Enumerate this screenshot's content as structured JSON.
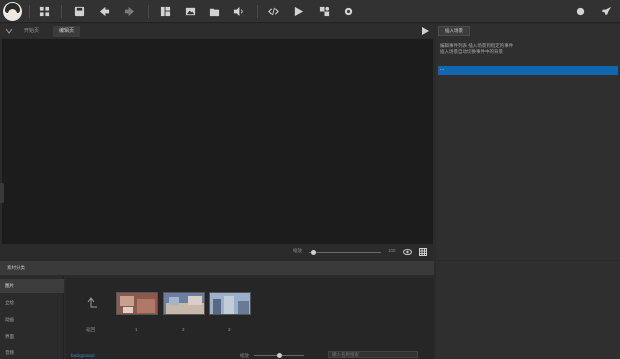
{
  "toolbar": {
    "buttons": [
      {
        "name": "project-grid-icon"
      },
      {
        "name": "save-icon"
      },
      {
        "name": "back-icon"
      },
      {
        "name": "forward-icon"
      },
      {
        "name": "layout-icon"
      },
      {
        "name": "image-icon"
      },
      {
        "name": "folder-icon"
      },
      {
        "name": "volume-icon"
      },
      {
        "name": "code-icon"
      },
      {
        "name": "play-icon"
      },
      {
        "name": "assets-icon"
      },
      {
        "name": "settings-icon"
      },
      {
        "name": "record-icon"
      },
      {
        "name": "rocket-icon"
      }
    ]
  },
  "editor": {
    "tabs": [
      {
        "label": "开始页",
        "active": false
      },
      {
        "label": "编辑页",
        "active": true
      }
    ]
  },
  "zoombar": {
    "zoom_label": "缩放",
    "zoom_value": 0.05,
    "percent_label": "100",
    "grid_icon": "grid-icon"
  },
  "right_panel": {
    "button_label": "插入场景",
    "hint_line1": "编辑事件列表 插入场景到指定的事件",
    "hint_line2": "插入场景自动切换事件中的背景",
    "selected_item": "..."
  },
  "bottom": {
    "title": "素材分类",
    "categories": [
      {
        "label": "图片",
        "active": true
      },
      {
        "label": "立绘",
        "active": false
      },
      {
        "label": "动画",
        "active": false
      },
      {
        "label": "界面",
        "active": false
      },
      {
        "label": "音频",
        "active": false
      }
    ],
    "parent_label": "返回",
    "thumbnails": [
      {
        "label": "1",
        "color": "#a87060"
      },
      {
        "label": "2",
        "color": "#7a8aa8"
      },
      {
        "label": "3",
        "color": "#8aa0c0"
      }
    ],
    "footer_link": "background",
    "footer_zoom_label": "缩放",
    "footer_search": "输入名称搜索"
  }
}
